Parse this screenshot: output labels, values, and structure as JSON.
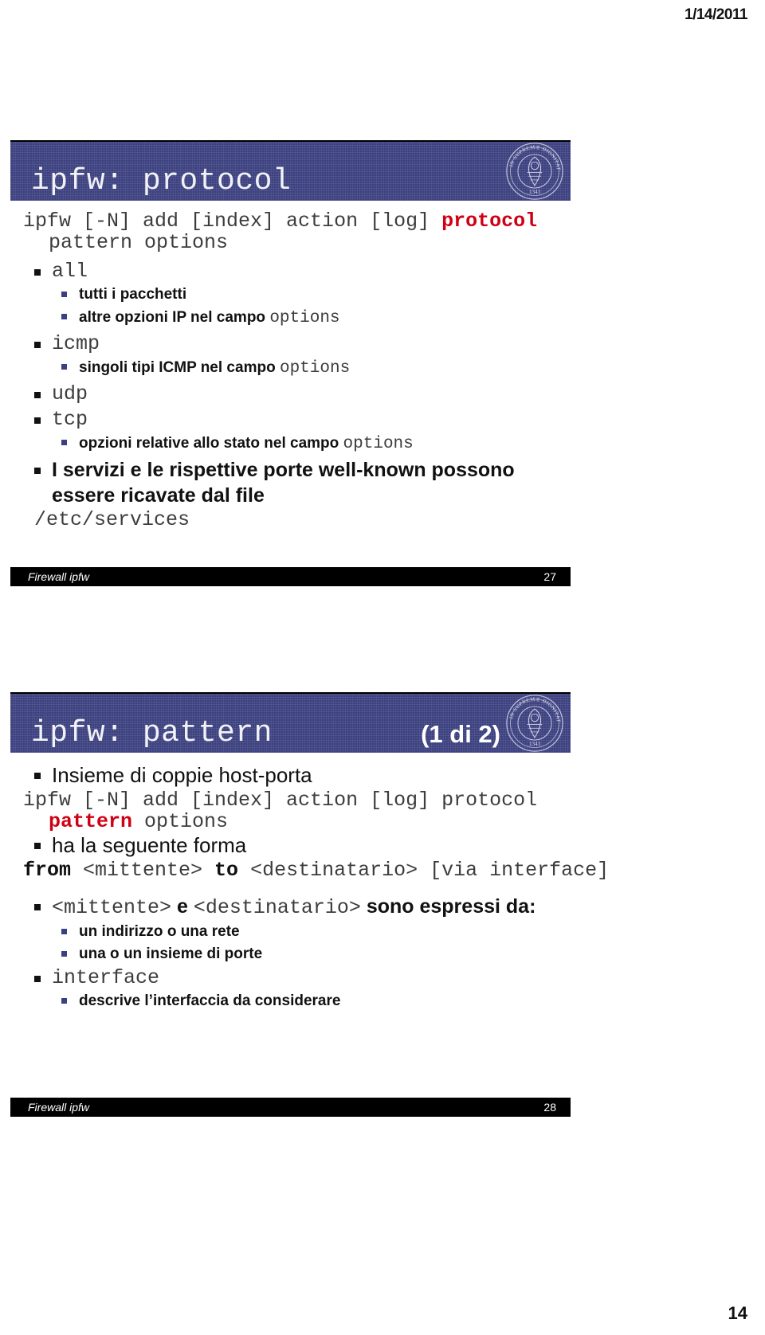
{
  "document": {
    "date_header": "1/14/2011",
    "page_number": "14"
  },
  "slides": [
    {
      "title": "ipfw: protocol",
      "title_suffix": "",
      "seal_text_outer": "IN SUPREMÆ DIGNITATIS",
      "seal_text_year": "1343",
      "syntax": {
        "part1": "ipfw [-N] add [index] action [log] ",
        "highlight": "protocol",
        "part2": "pattern options"
      },
      "bullets": [
        {
          "label": "all",
          "style": "mono",
          "children": [
            {
              "text": "tutti i pacchetti",
              "code_tail": ""
            },
            {
              "text": "altre opzioni IP nel campo ",
              "code_tail": "options"
            }
          ]
        },
        {
          "label": "icmp",
          "style": "mono",
          "children": [
            {
              "text": "singoli tipi ICMP nel campo ",
              "code_tail": "options"
            }
          ]
        },
        {
          "label": "udp",
          "style": "mono",
          "children": []
        },
        {
          "label": "tcp",
          "style": "mono",
          "children": [
            {
              "text": "opzioni relative allo stato nel campo ",
              "code_tail": "options"
            }
          ]
        },
        {
          "label": "I servizi e le rispettive porte well-known possono essere ricavate dal file",
          "style": "sans",
          "children": []
        }
      ],
      "trailing_code": "/etc/services",
      "footer": {
        "label": "Firewall ipfw",
        "number": "27"
      }
    },
    {
      "title": "ipfw: pattern",
      "title_suffix": "(1 di 2)",
      "seal_text_outer": "IN SUPREMÆ DIGNITATIS",
      "seal_text_year": "1343",
      "intro_bullet": "Insieme di coppie host-porta",
      "syntax": {
        "part1": "ipfw [-N] add [index] action [log] protocol",
        "highlight": "pattern",
        "part2": " options"
      },
      "form_bullet": "ha la seguente forma",
      "form_code": {
        "from": "from",
        "sender": " <mittente> ",
        "to": "to",
        "receiver": " <destinatario> ",
        "via": "[via interface]"
      },
      "expressed_line": {
        "mono1": "<mittente>",
        "sans1": " e ",
        "mono2": "<destinatario>",
        "sans2": " sono espressi da:"
      },
      "expressed_children": [
        "un indirizzo o una rete",
        "una o un insieme di porte"
      ],
      "interface_bullet": {
        "label": "interface",
        "children": [
          "descrive l’interfaccia da considerare"
        ]
      },
      "footer": {
        "label": "Firewall ipfw",
        "number": "28"
      }
    }
  ]
}
